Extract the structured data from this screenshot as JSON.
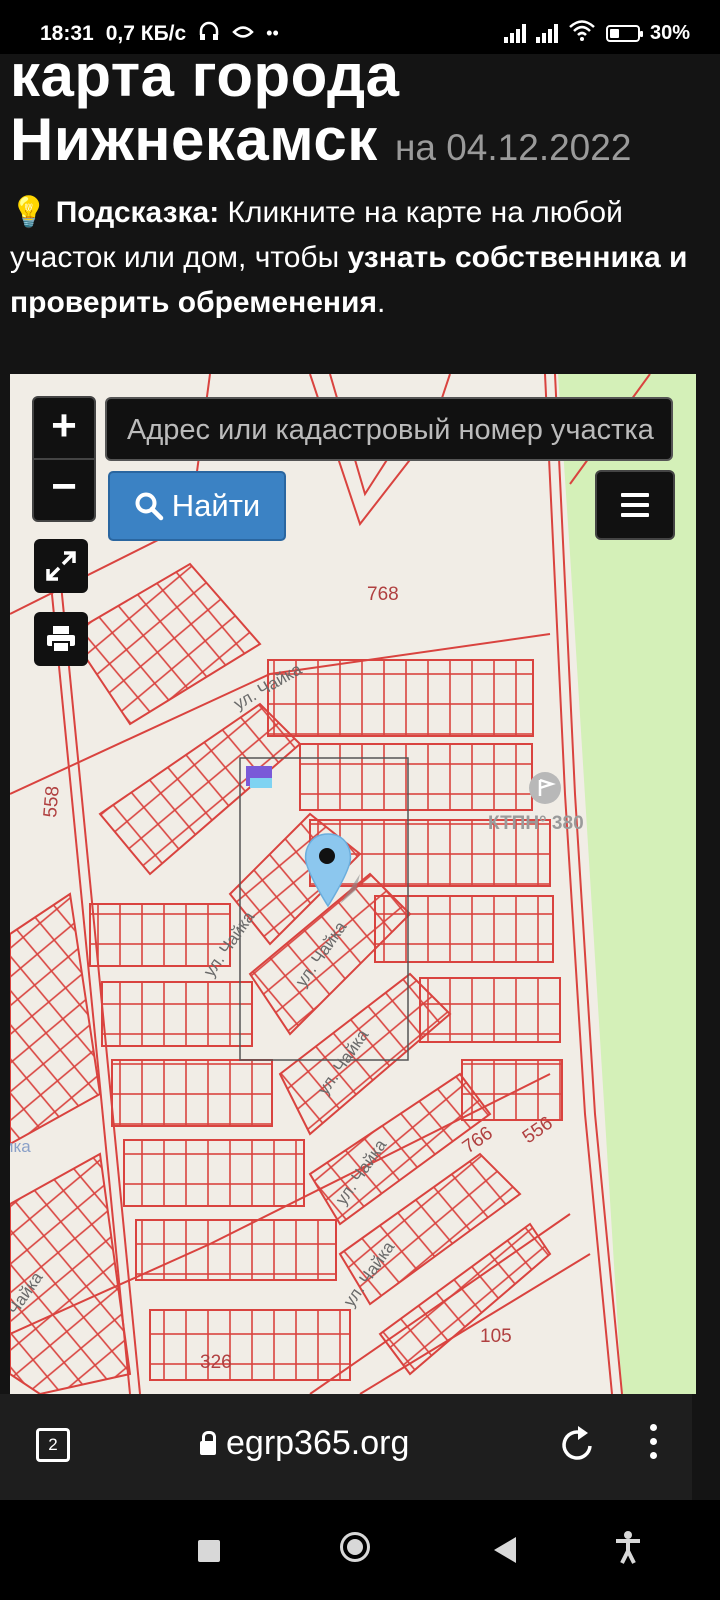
{
  "status_bar": {
    "time": "18:31",
    "net_speed": "0,7 КБ/с",
    "headphones_icon": "headphones-icon",
    "battery": "30%"
  },
  "page": {
    "title_line1": "карта города",
    "title_line2": "Нижнекамск",
    "title_date": "на 04.12.2022",
    "hint_icon": "💡",
    "hint_label": "Подсказка:",
    "hint_text1": "Кликните на карте на любой участок или дом, чтобы",
    "hint_bold": "узнать собственника и проверить обременения",
    "hint_end": "."
  },
  "map": {
    "zoom_in": "+",
    "zoom_out": "−",
    "search_placeholder": "Адрес или кадастровый номер участка",
    "find_button": "Найти",
    "labels": {
      "n768": "768",
      "n558": "558",
      "ktp": "КТПН° 380",
      "n766": "766",
      "n556": "556",
      "n105": "105",
      "n326": "326",
      "street": "ул. Чайка",
      "street_cut": "Чайка",
      "side_cut": "ика"
    }
  },
  "browser": {
    "tab_count": "2",
    "url": "egrp365.org"
  }
}
